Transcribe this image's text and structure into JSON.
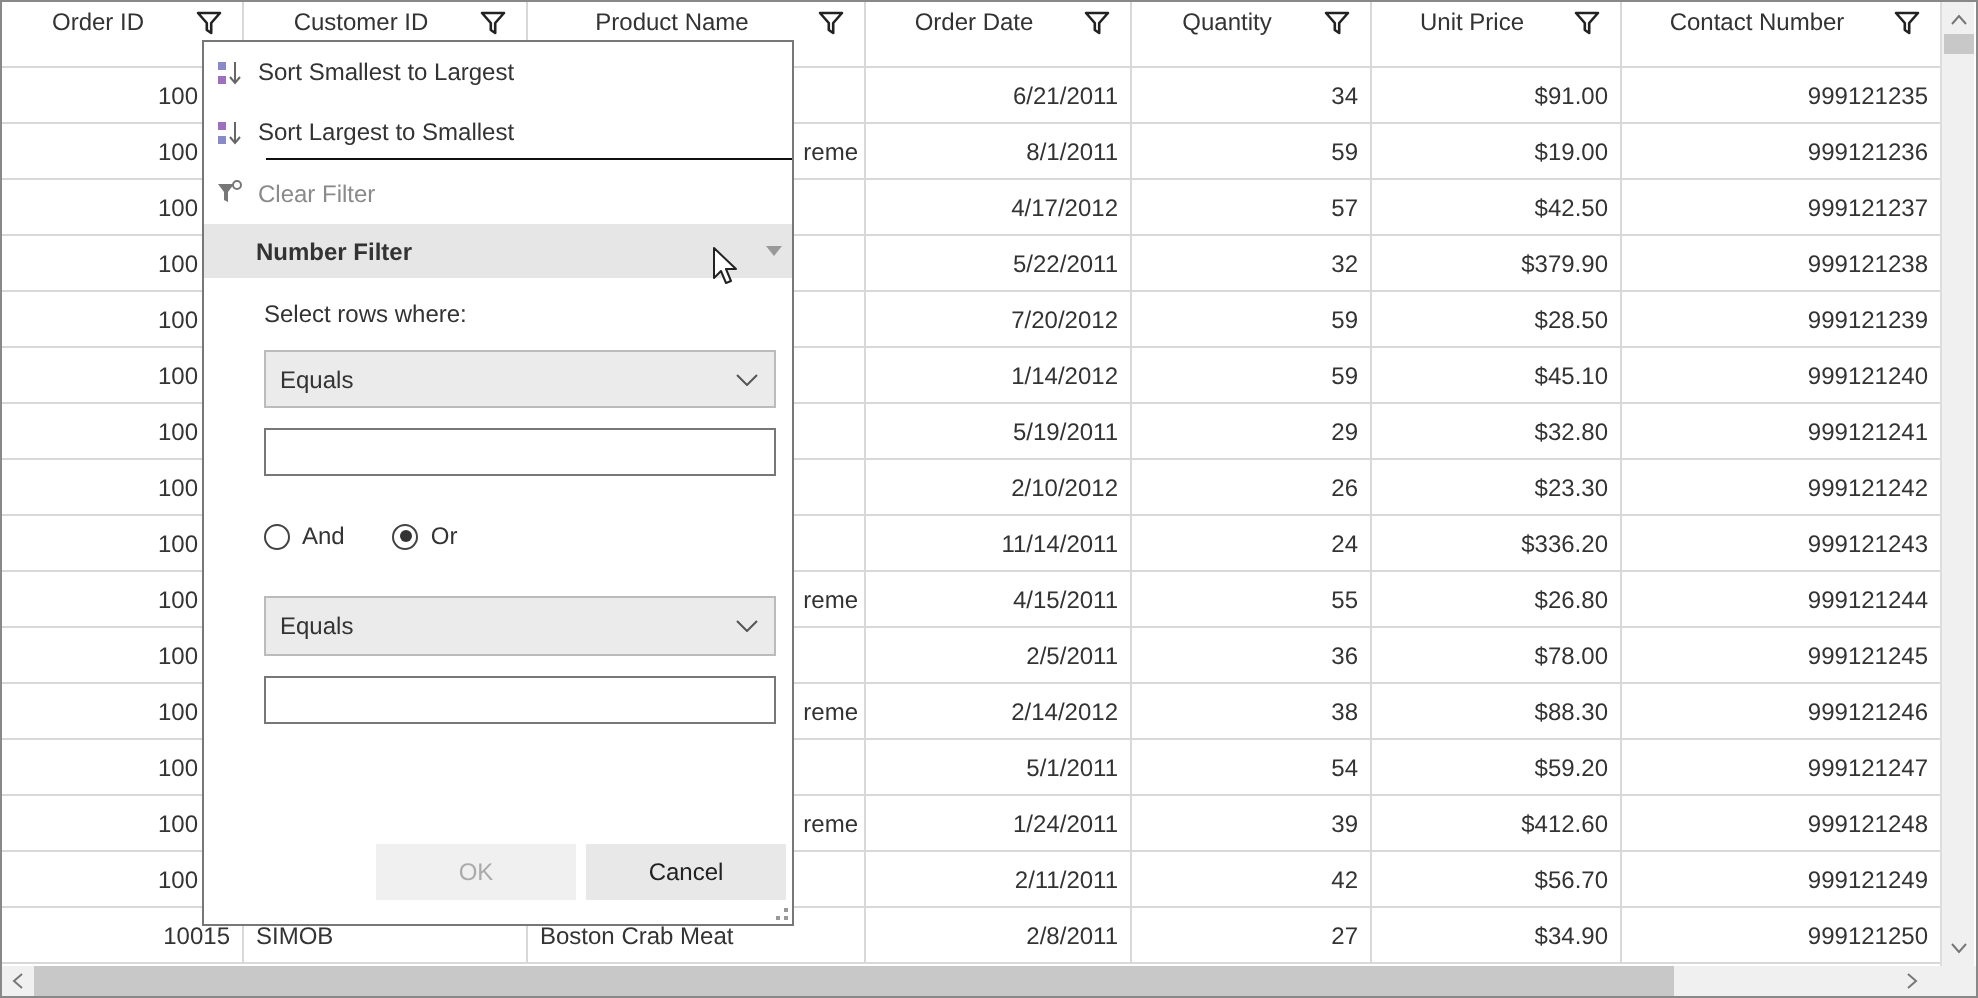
{
  "table": {
    "columns": [
      {
        "label": "Order ID"
      },
      {
        "label": "Customer ID"
      },
      {
        "label": "Product Name"
      },
      {
        "label": "Order Date"
      },
      {
        "label": "Quantity"
      },
      {
        "label": "Unit Price"
      },
      {
        "label": "Contact Number"
      }
    ],
    "rows": [
      {
        "order_id": "100",
        "order_date": "6/21/2011",
        "quantity": "34",
        "unit_price": "$91.00",
        "contact_number": "999121235"
      },
      {
        "order_id": "100",
        "product_name": "reme",
        "order_date": "8/1/2011",
        "quantity": "59",
        "unit_price": "$19.00",
        "contact_number": "999121236"
      },
      {
        "order_id": "100",
        "order_date": "4/17/2012",
        "quantity": "57",
        "unit_price": "$42.50",
        "contact_number": "999121237"
      },
      {
        "order_id": "100",
        "order_date": "5/22/2011",
        "quantity": "32",
        "unit_price": "$379.90",
        "contact_number": "999121238"
      },
      {
        "order_id": "100",
        "order_date": "7/20/2012",
        "quantity": "59",
        "unit_price": "$28.50",
        "contact_number": "999121239"
      },
      {
        "order_id": "100",
        "order_date": "1/14/2012",
        "quantity": "59",
        "unit_price": "$45.10",
        "contact_number": "999121240"
      },
      {
        "order_id": "100",
        "order_date": "5/19/2011",
        "quantity": "29",
        "unit_price": "$32.80",
        "contact_number": "999121241"
      },
      {
        "order_id": "100",
        "order_date": "2/10/2012",
        "quantity": "26",
        "unit_price": "$23.30",
        "contact_number": "999121242"
      },
      {
        "order_id": "100",
        "order_date": "11/14/2011",
        "quantity": "24",
        "unit_price": "$336.20",
        "contact_number": "999121243"
      },
      {
        "order_id": "100",
        "product_name": "reme",
        "order_date": "4/15/2011",
        "quantity": "55",
        "unit_price": "$26.80",
        "contact_number": "999121244"
      },
      {
        "order_id": "100",
        "order_date": "2/5/2011",
        "quantity": "36",
        "unit_price": "$78.00",
        "contact_number": "999121245"
      },
      {
        "order_id": "100",
        "product_name": "reme",
        "order_date": "2/14/2012",
        "quantity": "38",
        "unit_price": "$88.30",
        "contact_number": "999121246"
      },
      {
        "order_id": "100",
        "order_date": "5/1/2011",
        "quantity": "54",
        "unit_price": "$59.20",
        "contact_number": "999121247"
      },
      {
        "order_id": "100",
        "product_name": "reme",
        "order_date": "1/24/2011",
        "quantity": "39",
        "unit_price": "$412.60",
        "contact_number": "999121248"
      },
      {
        "order_id": "100",
        "order_date": "2/11/2011",
        "quantity": "42",
        "unit_price": "$56.70",
        "contact_number": "999121249"
      },
      {
        "order_id": "10015",
        "customer_id": "SIMOB",
        "product_name": "Boston Crab Meat",
        "order_date": "2/8/2011",
        "quantity": "27",
        "unit_price": "$34.90",
        "contact_number": "999121250"
      }
    ]
  },
  "filter_popup": {
    "sort_items": [
      {
        "label": "Sort Smallest to Largest",
        "kind": "ascending"
      },
      {
        "label": "Sort Largest to Smallest",
        "kind": "descending"
      }
    ],
    "clear_filter": {
      "label": "Clear Filter",
      "disabled": true
    },
    "section": {
      "label": "Number Filter",
      "expanded": true
    },
    "prompt": "Select rows where:",
    "conditions": [
      {
        "operator": "Equals"
      },
      {
        "operator": "Equals"
      }
    ],
    "logic": [
      {
        "label": "And",
        "selected": false
      },
      {
        "label": "Or",
        "selected": true
      }
    ],
    "buttons": [
      {
        "label": "OK",
        "disabled": true
      },
      {
        "label": "Cancel",
        "disabled": false
      }
    ]
  }
}
